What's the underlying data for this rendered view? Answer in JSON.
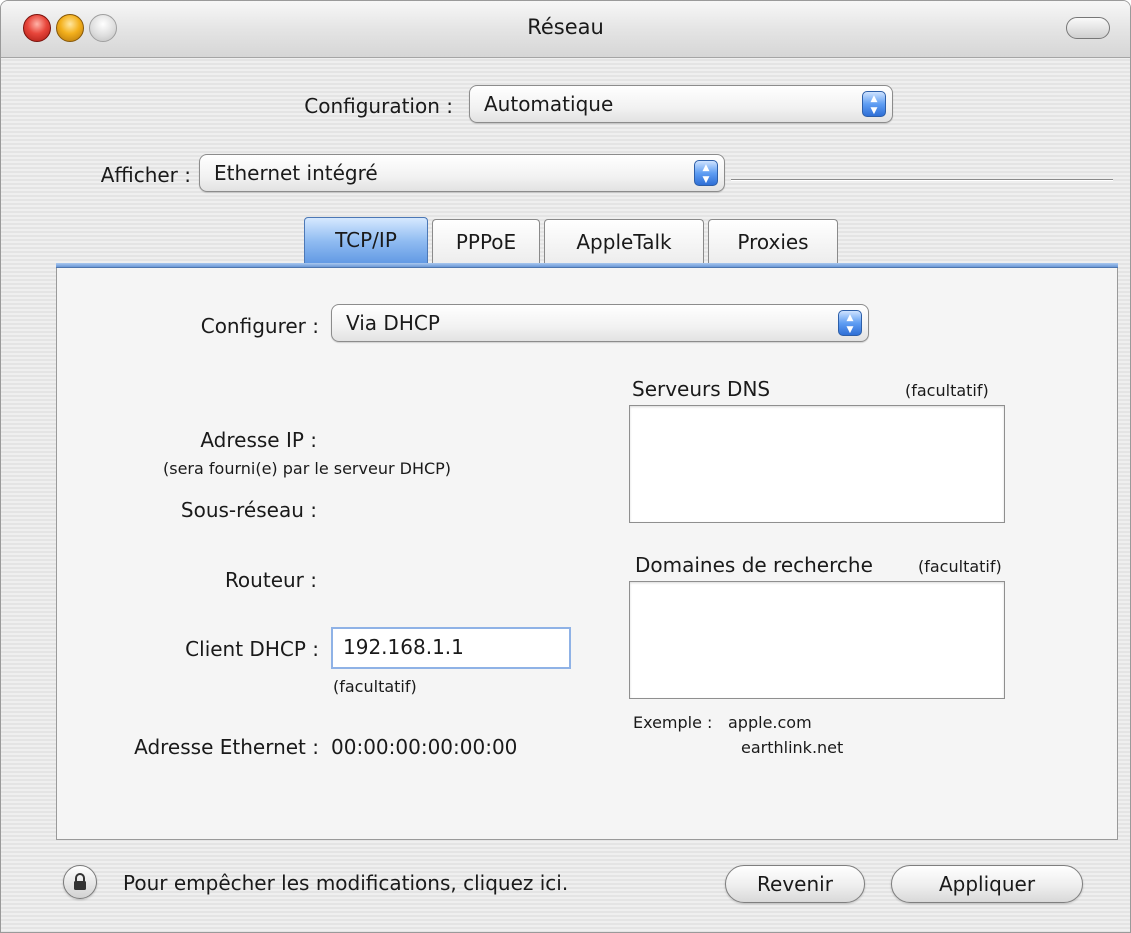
{
  "window": {
    "title": "Réseau"
  },
  "configuration": {
    "label": "Configuration :",
    "selected": "Automatique"
  },
  "afficher": {
    "label": "Afficher :",
    "selected": "Ethernet intégré"
  },
  "tabs": [
    {
      "label": "TCP/IP",
      "active": true
    },
    {
      "label": "PPPoE",
      "active": false
    },
    {
      "label": "AppleTalk",
      "active": false
    },
    {
      "label": "Proxies",
      "active": false
    }
  ],
  "tcpip": {
    "configurer": {
      "label": "Configurer :",
      "selected": "Via DHCP"
    },
    "ip_address": {
      "label": "Adresse IP :",
      "note": "(sera fourni(e) par le serveur DHCP)"
    },
    "subnet": {
      "label": "Sous-réseau :"
    },
    "router": {
      "label": "Routeur :"
    },
    "dhcp_client": {
      "label": "Client DHCP :",
      "value": "192.168.1.1",
      "note": "(facultatif)"
    },
    "ethernet_address": {
      "label": "Adresse Ethernet :",
      "value": "00:00:00:00:00:00"
    },
    "dns": {
      "label": "Serveurs DNS",
      "optional": "(facultatif)"
    },
    "search_domains": {
      "label": "Domaines de recherche",
      "optional": "(facultatif)"
    },
    "example": {
      "label": "Exemple :",
      "line1": "apple.com",
      "line2": "earthlink.net"
    }
  },
  "footer": {
    "lock_text": "Pour empêcher les modifications, cliquez ici.",
    "revert_label": "Revenir",
    "apply_label": "Appliquer"
  }
}
